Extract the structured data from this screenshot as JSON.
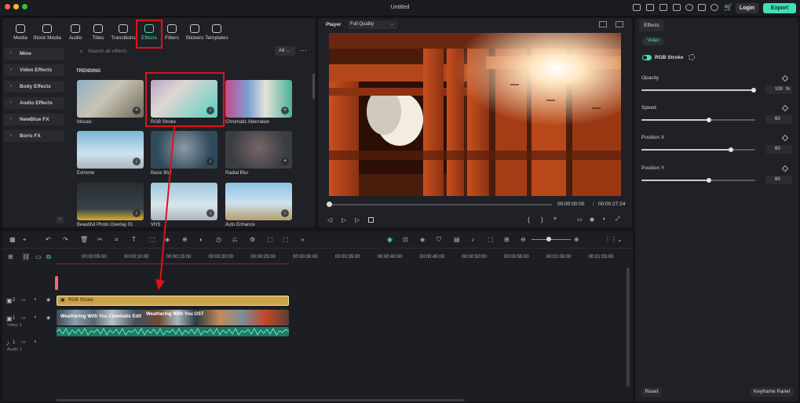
{
  "window": {
    "title": "Untitled"
  },
  "header": {
    "login_label": "Login",
    "export_label": "Export"
  },
  "media_tabs": [
    {
      "label": "Media",
      "icon": "media-icon"
    },
    {
      "label": "Stock Media",
      "icon": "stock-media-icon"
    },
    {
      "label": "Audio",
      "icon": "music-note-icon"
    },
    {
      "label": "Titles",
      "icon": "text-icon"
    },
    {
      "label": "Transitions",
      "icon": "transitions-icon"
    },
    {
      "label": "Effects",
      "icon": "effects-icon",
      "active": true
    },
    {
      "label": "Filters",
      "icon": "filters-icon"
    },
    {
      "label": "Stickers",
      "icon": "stickers-icon"
    },
    {
      "label": "Templates",
      "icon": "templates-icon"
    }
  ],
  "sidebar": {
    "items": [
      "Mine",
      "Video Effects",
      "Body Effects",
      "Audio Effects",
      "NewBlue FX",
      "Boris FX"
    ]
  },
  "search": {
    "placeholder": "Search all effects",
    "filter_value": "All"
  },
  "browser": {
    "section_title": "TRENDING",
    "effects": [
      {
        "name": "Mosaic"
      },
      {
        "name": "RGB Stroke"
      },
      {
        "name": "Chromatic Aberration"
      },
      {
        "name": "Extreme"
      },
      {
        "name": "Basic Blur"
      },
      {
        "name": "Radial Blur"
      },
      {
        "name": "Beautiful Photo Overlay 01"
      },
      {
        "name": "VHS"
      },
      {
        "name": "Auto Enhance"
      }
    ]
  },
  "player": {
    "label": "Player",
    "quality": "Full Quality",
    "current_time": "00:00:00:00",
    "separator": "/",
    "total_time": "00:00:27:24",
    "progress": 0.0
  },
  "timeline": {
    "ruler": [
      "00:00:05:00",
      "00:00:10:00",
      "00:00:15:00",
      "00:00:20:00",
      "00:00:25:00",
      "00:00:30:00",
      "00:00:35:00",
      "00:00:40:00",
      "00:00:45:00",
      "00:00:50:00",
      "00:00:55:00",
      "00:01:00:00",
      "00:01:05:00"
    ],
    "effect_clip": "RGB Stroke",
    "video_clip_1": "Weathering With You Cinematic Edit",
    "video_clip_2": "Weathering With You OST",
    "tracks": [
      {
        "number": "2",
        "name": ""
      },
      {
        "number": "1",
        "name": "Video 1"
      },
      {
        "number": "1",
        "name": "Audio 1"
      }
    ]
  },
  "effects_panel": {
    "tab": "Effects",
    "subtab": "Video",
    "effect_name": "RGB Stroke",
    "effect_enabled": true,
    "params": [
      {
        "label": "Opacity",
        "value": "100",
        "unit": "%",
        "level": 1.0
      },
      {
        "label": "Speed",
        "value": "60",
        "unit": "",
        "level": 0.6
      },
      {
        "label": "Position X",
        "value": "60",
        "unit": "",
        "level": 0.8
      },
      {
        "label": "Position Y",
        "value": "60",
        "unit": "",
        "level": 0.6
      }
    ],
    "reset_label": "Reset",
    "keyframe_label": "Keyframe Panel"
  },
  "colors": {
    "accent": "#3ee0b6",
    "highlight": "#e0121b",
    "effect_clip": "#c9a24a"
  }
}
